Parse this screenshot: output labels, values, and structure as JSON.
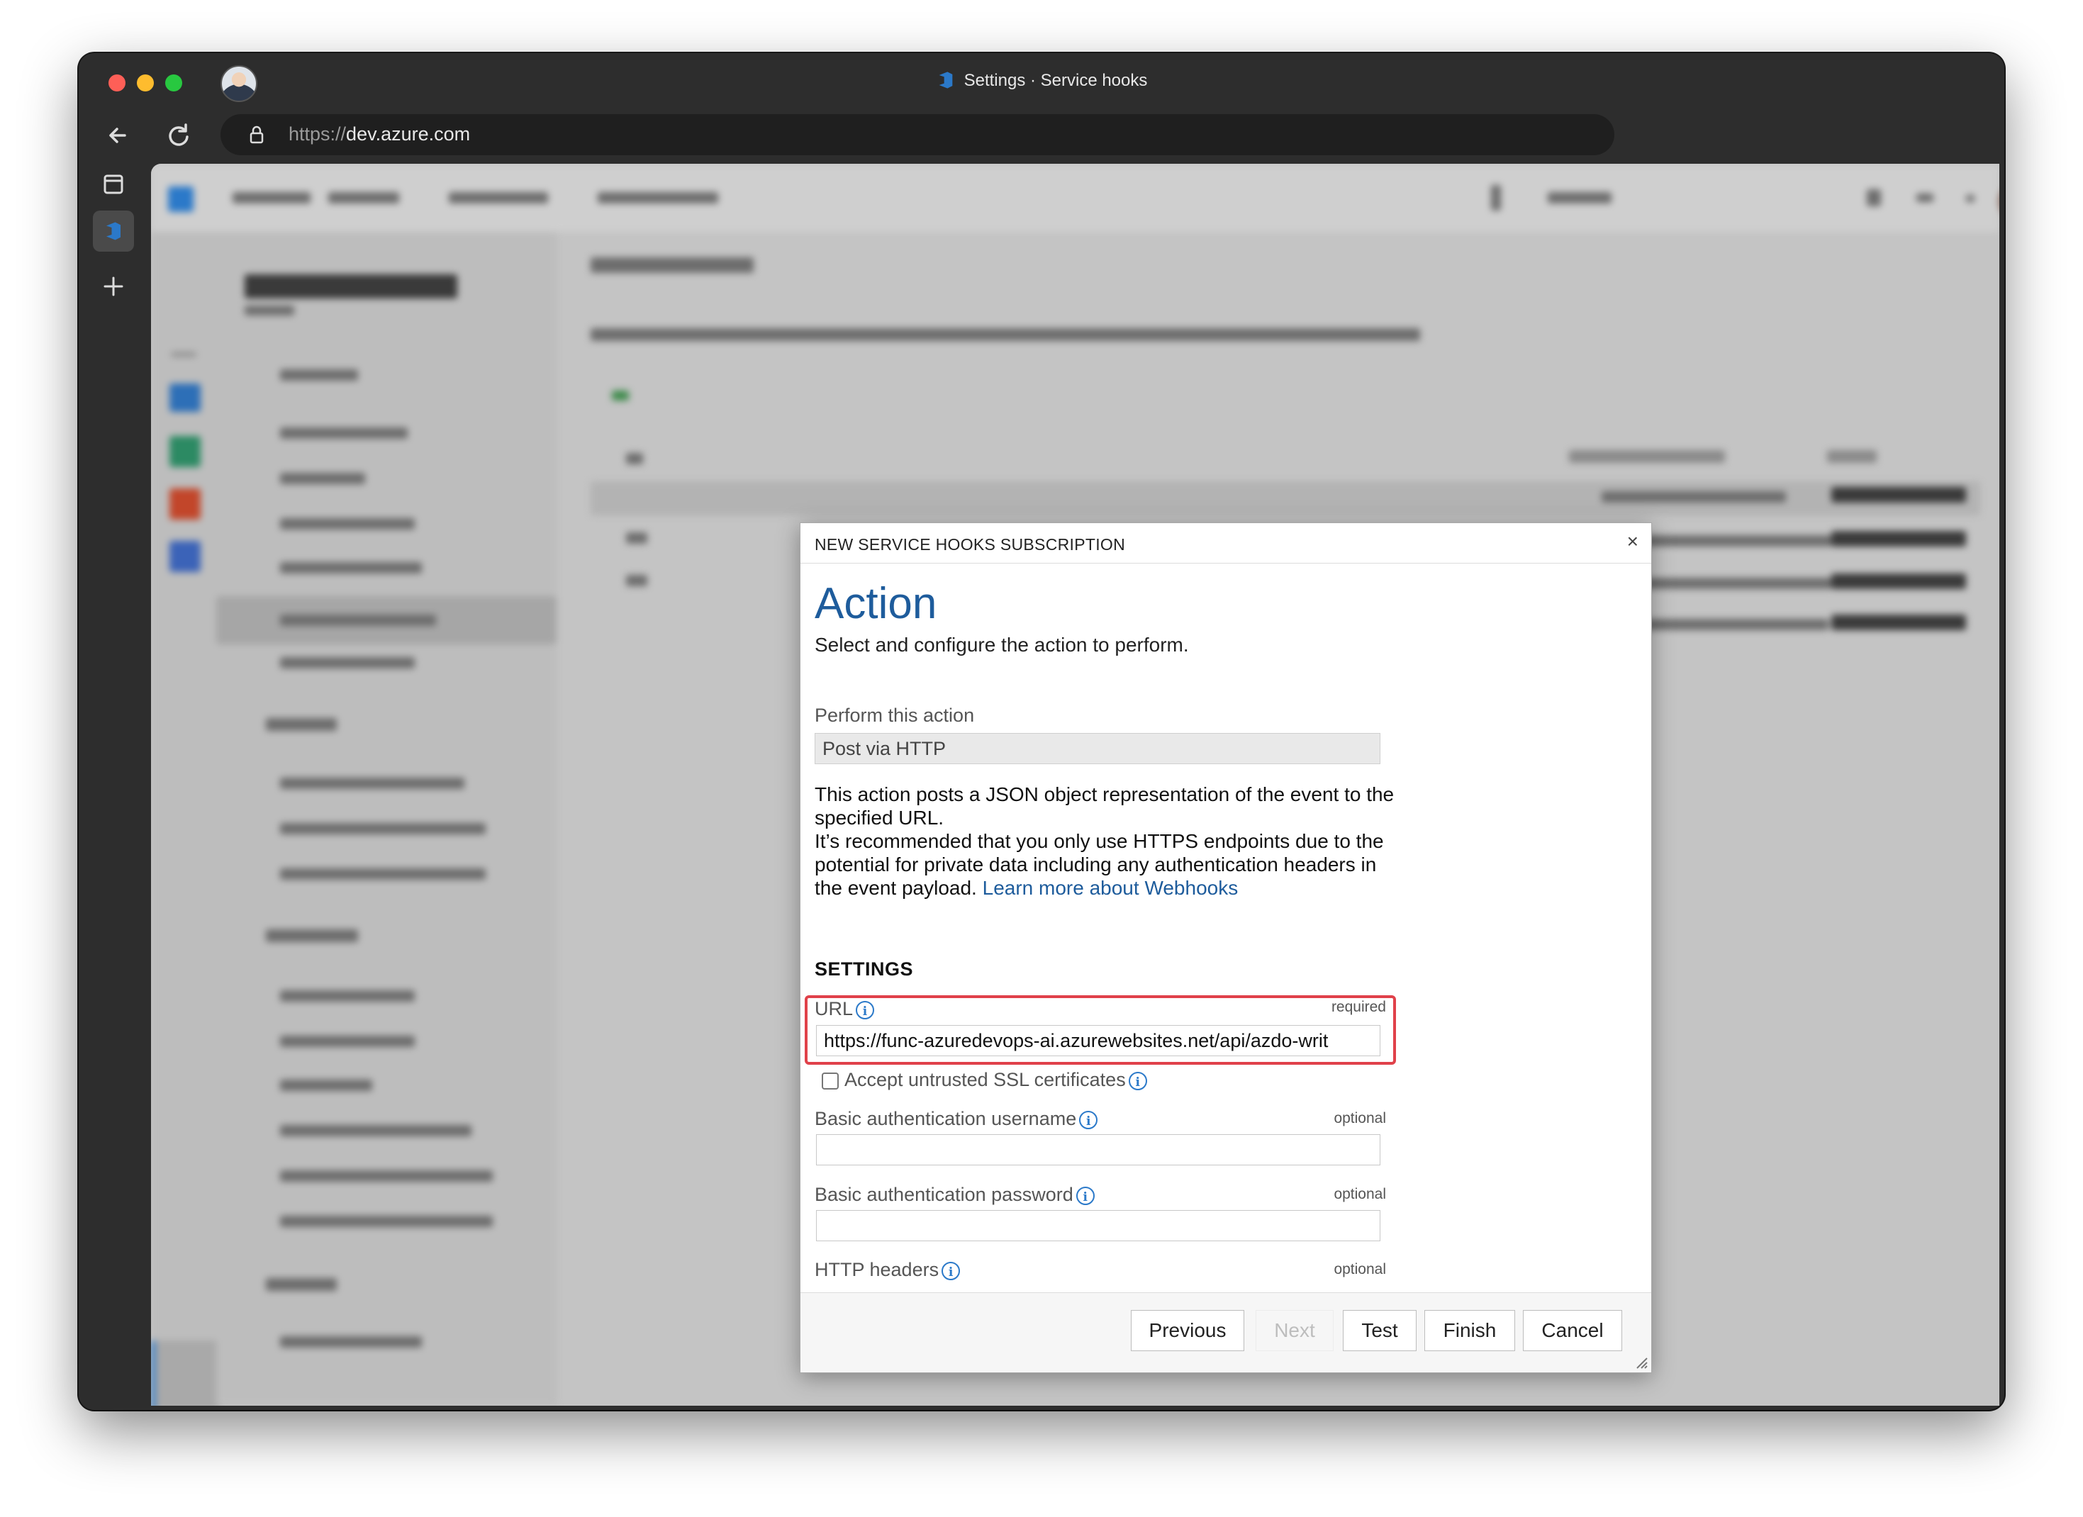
{
  "browser": {
    "window_title": "Settings · Service hooks",
    "url_scheme": "https://",
    "url_host": "dev.azure.com"
  },
  "dialog": {
    "header": "NEW SERVICE HOOKS SUBSCRIPTION",
    "close_glyph": "×",
    "heading": "Action",
    "subheading": "Select and configure the action to perform.",
    "perform_label": "Perform this action",
    "perform_value": "Post via HTTP",
    "description": "This action posts a JSON object representation of the event to the specified URL.",
    "recommendation": "It’s recommended that you only use HTTPS endpoints due to the potential for private data including any authentication headers in the event payload.",
    "learn_more_link": "Learn more about Webhooks",
    "settings_heading": "SETTINGS",
    "url_label": "URL",
    "url_tag": "required",
    "url_value": "https://func-azuredevops-ai.azurewebsites.net/api/azdo-writ",
    "ssl_label": "Accept untrusted SSL certificates",
    "ssl_checked": false,
    "username_label": "Basic authentication username",
    "username_tag": "optional",
    "username_value": "",
    "password_label": "Basic authentication password",
    "password_tag": "optional",
    "password_value": "",
    "headers_label": "HTTP headers",
    "headers_tag": "optional",
    "info_glyph": "i"
  },
  "footer": {
    "previous": "Previous",
    "next": "Next",
    "test": "Test",
    "finish": "Finish",
    "cancel": "Cancel"
  },
  "colors": {
    "accent_blue": "#1e5c9c",
    "highlight_red": "#e0414a",
    "azure_devops_blue": "#2b79c9"
  },
  "icons": [
    "back-arrow-icon",
    "reload-icon",
    "lock-icon",
    "sidebar-toggle-icon",
    "azure-devops-icon",
    "new-tab-plus-icon",
    "info-icon",
    "close-icon",
    "resize-grip-icon"
  ]
}
